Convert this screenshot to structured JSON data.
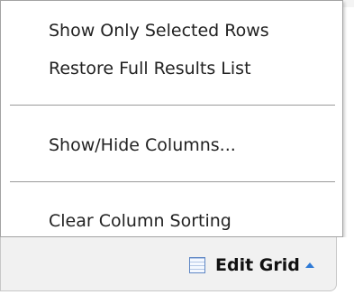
{
  "menu": {
    "items": [
      {
        "label": "Show Only Selected Rows"
      },
      {
        "label": "Restore Full Results List"
      },
      {
        "label": "Show/Hide Columns..."
      },
      {
        "label": "Clear Column Sorting"
      }
    ]
  },
  "footer": {
    "edit_grid_label": "Edit Grid",
    "grid_icon": "grid-icon",
    "caret_icon": "caret-up-icon",
    "accent_color": "#2f7ad6"
  }
}
